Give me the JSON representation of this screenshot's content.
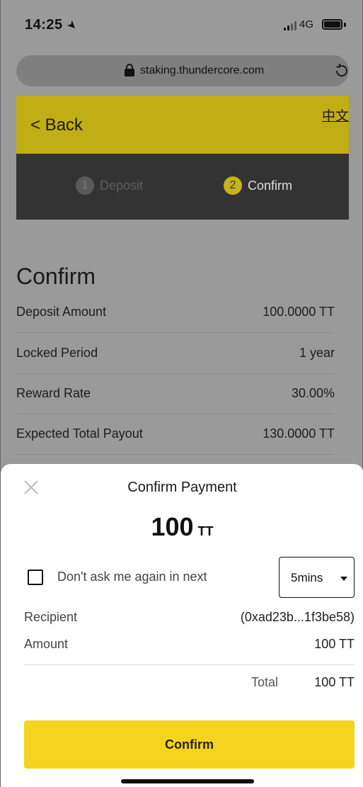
{
  "status_bar": {
    "time": "14:25",
    "network": "4G"
  },
  "browser": {
    "url": "staking.thundercore.com"
  },
  "header": {
    "back_label": "< Back",
    "language_label": "中文"
  },
  "steps": [
    {
      "number": "1",
      "label": "Deposit"
    },
    {
      "number": "2",
      "label": "Confirm"
    }
  ],
  "confirm_section": {
    "title": "Confirm",
    "rows": [
      {
        "label": "Deposit Amount",
        "value": "100.0000 TT"
      },
      {
        "label": "Locked Period",
        "value": "1 year"
      },
      {
        "label": "Reward Rate",
        "value": "30.00%"
      },
      {
        "label": "Expected Total Payout",
        "value": "130.0000 TT"
      }
    ]
  },
  "payment_sheet": {
    "title": "Confirm Payment",
    "amount": "100",
    "unit": "TT",
    "checkbox_label": "Don't ask me again in next",
    "select_value": "5mins",
    "recipient_label": "Recipient",
    "recipient_value": "(0xad23b...1f3be58)",
    "amount_label": "Amount",
    "amount_value": "100 TT",
    "total_label": "Total",
    "total_value": "100 TT",
    "confirm_button": "Confirm"
  },
  "colors": {
    "accent_yellow": "#f4d41e",
    "header_gold": "#c1ad14",
    "steps_bg": "#333333"
  }
}
